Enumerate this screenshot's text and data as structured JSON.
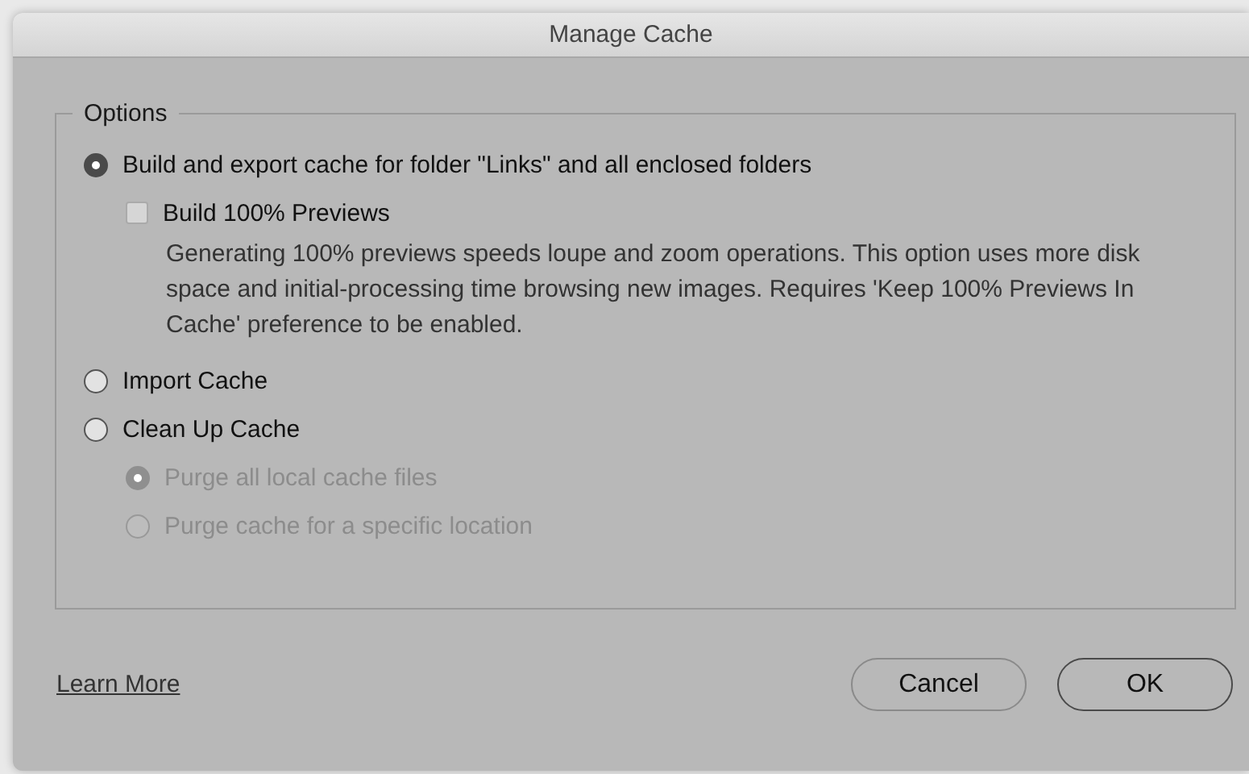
{
  "window": {
    "title": "Manage Cache"
  },
  "options": {
    "legend": "Options",
    "items": [
      {
        "kind": "radio",
        "label": "Build and export cache for folder \"Links\" and all enclosed folders",
        "selected": true,
        "disabled": false,
        "children": [
          {
            "kind": "checkbox",
            "label": "Build 100% Previews",
            "checked": false,
            "description": "Generating 100% previews speeds loupe and zoom operations. This option uses more disk space and initial-processing time browsing new images. Requires 'Keep 100% Previews In Cache' preference to be enabled."
          }
        ]
      },
      {
        "kind": "radio",
        "label": "Import Cache",
        "selected": false,
        "disabled": false
      },
      {
        "kind": "radio",
        "label": "Clean Up Cache",
        "selected": false,
        "disabled": false,
        "children": [
          {
            "kind": "radio",
            "label": "Purge all local cache files",
            "selected": true,
            "disabled": true
          },
          {
            "kind": "radio",
            "label": "Purge cache for a specific location",
            "selected": false,
            "disabled": true
          }
        ]
      }
    ]
  },
  "footer": {
    "link": "Learn More",
    "buttons": [
      {
        "label": "Cancel",
        "kind": "secondary"
      },
      {
        "label": "OK",
        "kind": "default"
      }
    ]
  }
}
